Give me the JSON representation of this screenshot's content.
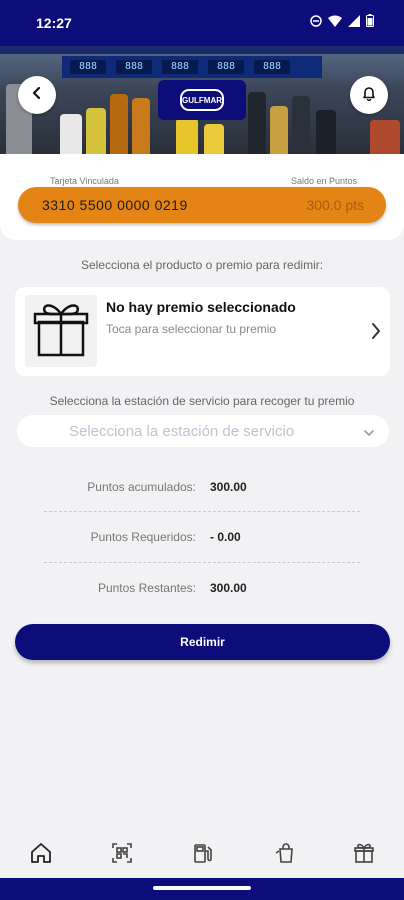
{
  "status_bar": {
    "time": "12:27",
    "icons": [
      "dnd-icon",
      "wifi-icon",
      "signal-icon",
      "battery-icon"
    ]
  },
  "header": {
    "back_icon": "chevron-left-icon",
    "notifications_icon": "bell-icon",
    "logo_text": "GULFMAR",
    "price_display": [
      "888",
      "888",
      "888",
      "888",
      "888"
    ]
  },
  "card": {
    "left_label": "Tarjeta Vinculada",
    "right_label": "Saldo en Puntos",
    "number": "3310 5500 0000 0219",
    "points": "300.0 pts"
  },
  "product_section": {
    "label": "Selecciona el producto o premio para redimir:",
    "prize_title": "No hay premio seleccionado",
    "prize_subtitle": "Toca para seleccionar tu premio"
  },
  "station_section": {
    "label": "Selecciona la estación de servicio para recoger tu premio",
    "placeholder": "Selecciona la estación de servicio"
  },
  "points_summary": [
    {
      "label": "Puntos acumulados:",
      "value": "300.00"
    },
    {
      "label": "Puntos Requeridos:",
      "value": "- 0.00"
    },
    {
      "label": "Puntos Restantes:",
      "value": "300.00"
    }
  ],
  "redeem_button": "Redimir",
  "bottom_nav": [
    "home-icon",
    "qr-code-icon",
    "fuel-pump-icon",
    "shopping-bag-icon",
    "gift-icon"
  ],
  "colors": {
    "primary": "#0c0d7a",
    "accent": "#e48414",
    "background": "#f2f2f4"
  }
}
